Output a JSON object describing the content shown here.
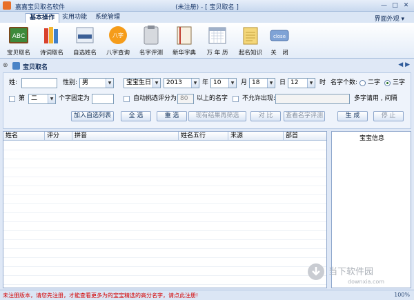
{
  "app": {
    "name": "嘉嘉宝贝取名软件",
    "window_title": "(未注册) - [ 宝贝取名 ]"
  },
  "menu": {
    "tabs": [
      "基本操作",
      "实用功能",
      "系统管理"
    ],
    "right": "界面外观"
  },
  "ribbon": {
    "buttons": [
      {
        "label": "宝贝取名",
        "icon": "abc-board-icon"
      },
      {
        "label": "诗词取名",
        "icon": "books-icon"
      },
      {
        "label": "自选姓名",
        "icon": "name-card-icon"
      },
      {
        "label": "八字查询",
        "icon": "bazi-badge-icon"
      },
      {
        "label": "名字评测",
        "icon": "clipboard-icon"
      },
      {
        "label": "新华字典",
        "icon": "dictionary-icon"
      },
      {
        "label": "万 年 历",
        "icon": "calendar-icon"
      },
      {
        "label": "起名知识",
        "icon": "notepad-icon"
      },
      {
        "label": "关　闭",
        "icon": "close-icon",
        "badge": "close"
      }
    ]
  },
  "panel": {
    "title": "宝贝取名"
  },
  "form": {
    "surname_label": "姓:",
    "surname_value": "",
    "gender_label": "性别:",
    "gender_value": "男",
    "birth_type": "宝宝生日",
    "year": "2013",
    "year_label": "年",
    "month": "10",
    "month_label": "月",
    "day": "18",
    "day_label": "日",
    "hour": "12",
    "hour_label": "时",
    "name_len_label": "名字个数:",
    "name_len_two": "二字",
    "name_len_three": "三字",
    "fix_prefix": "第",
    "fix_pos": "二",
    "fix_suffix": "个字固定为",
    "fix_value": "",
    "auto_pick_label": "自动挑选评分为",
    "auto_pick_score": "80",
    "auto_pick_suffix": "以上的名字",
    "disallow_label": "不允许出现:",
    "disallow_value": "",
    "multi_hint": "多字请用 , 间隔"
  },
  "buttons": {
    "add_list": "加入自选列表",
    "select_all": "全 选",
    "reselect": "重 选",
    "refilter": "现有结果再筛选",
    "compare": "对 比",
    "view_eval": "查看名字评测",
    "generate": "生 成",
    "stop": "停 止"
  },
  "table": {
    "headers": [
      "姓名",
      "评分",
      "拼音",
      "姓名五行",
      "来源",
      "部首"
    ]
  },
  "info_panel": {
    "title": "宝宝信息"
  },
  "status": {
    "text": "未注册版本，请您先注册，才能查看更多为的宝宝精选的高分名字，请点此注册!",
    "zoom": "100%"
  },
  "watermark": {
    "cn": "当下软件园",
    "url": "downxia.com"
  },
  "colors": {
    "accent": "#2d5a9a",
    "status_text": "#d40000"
  }
}
